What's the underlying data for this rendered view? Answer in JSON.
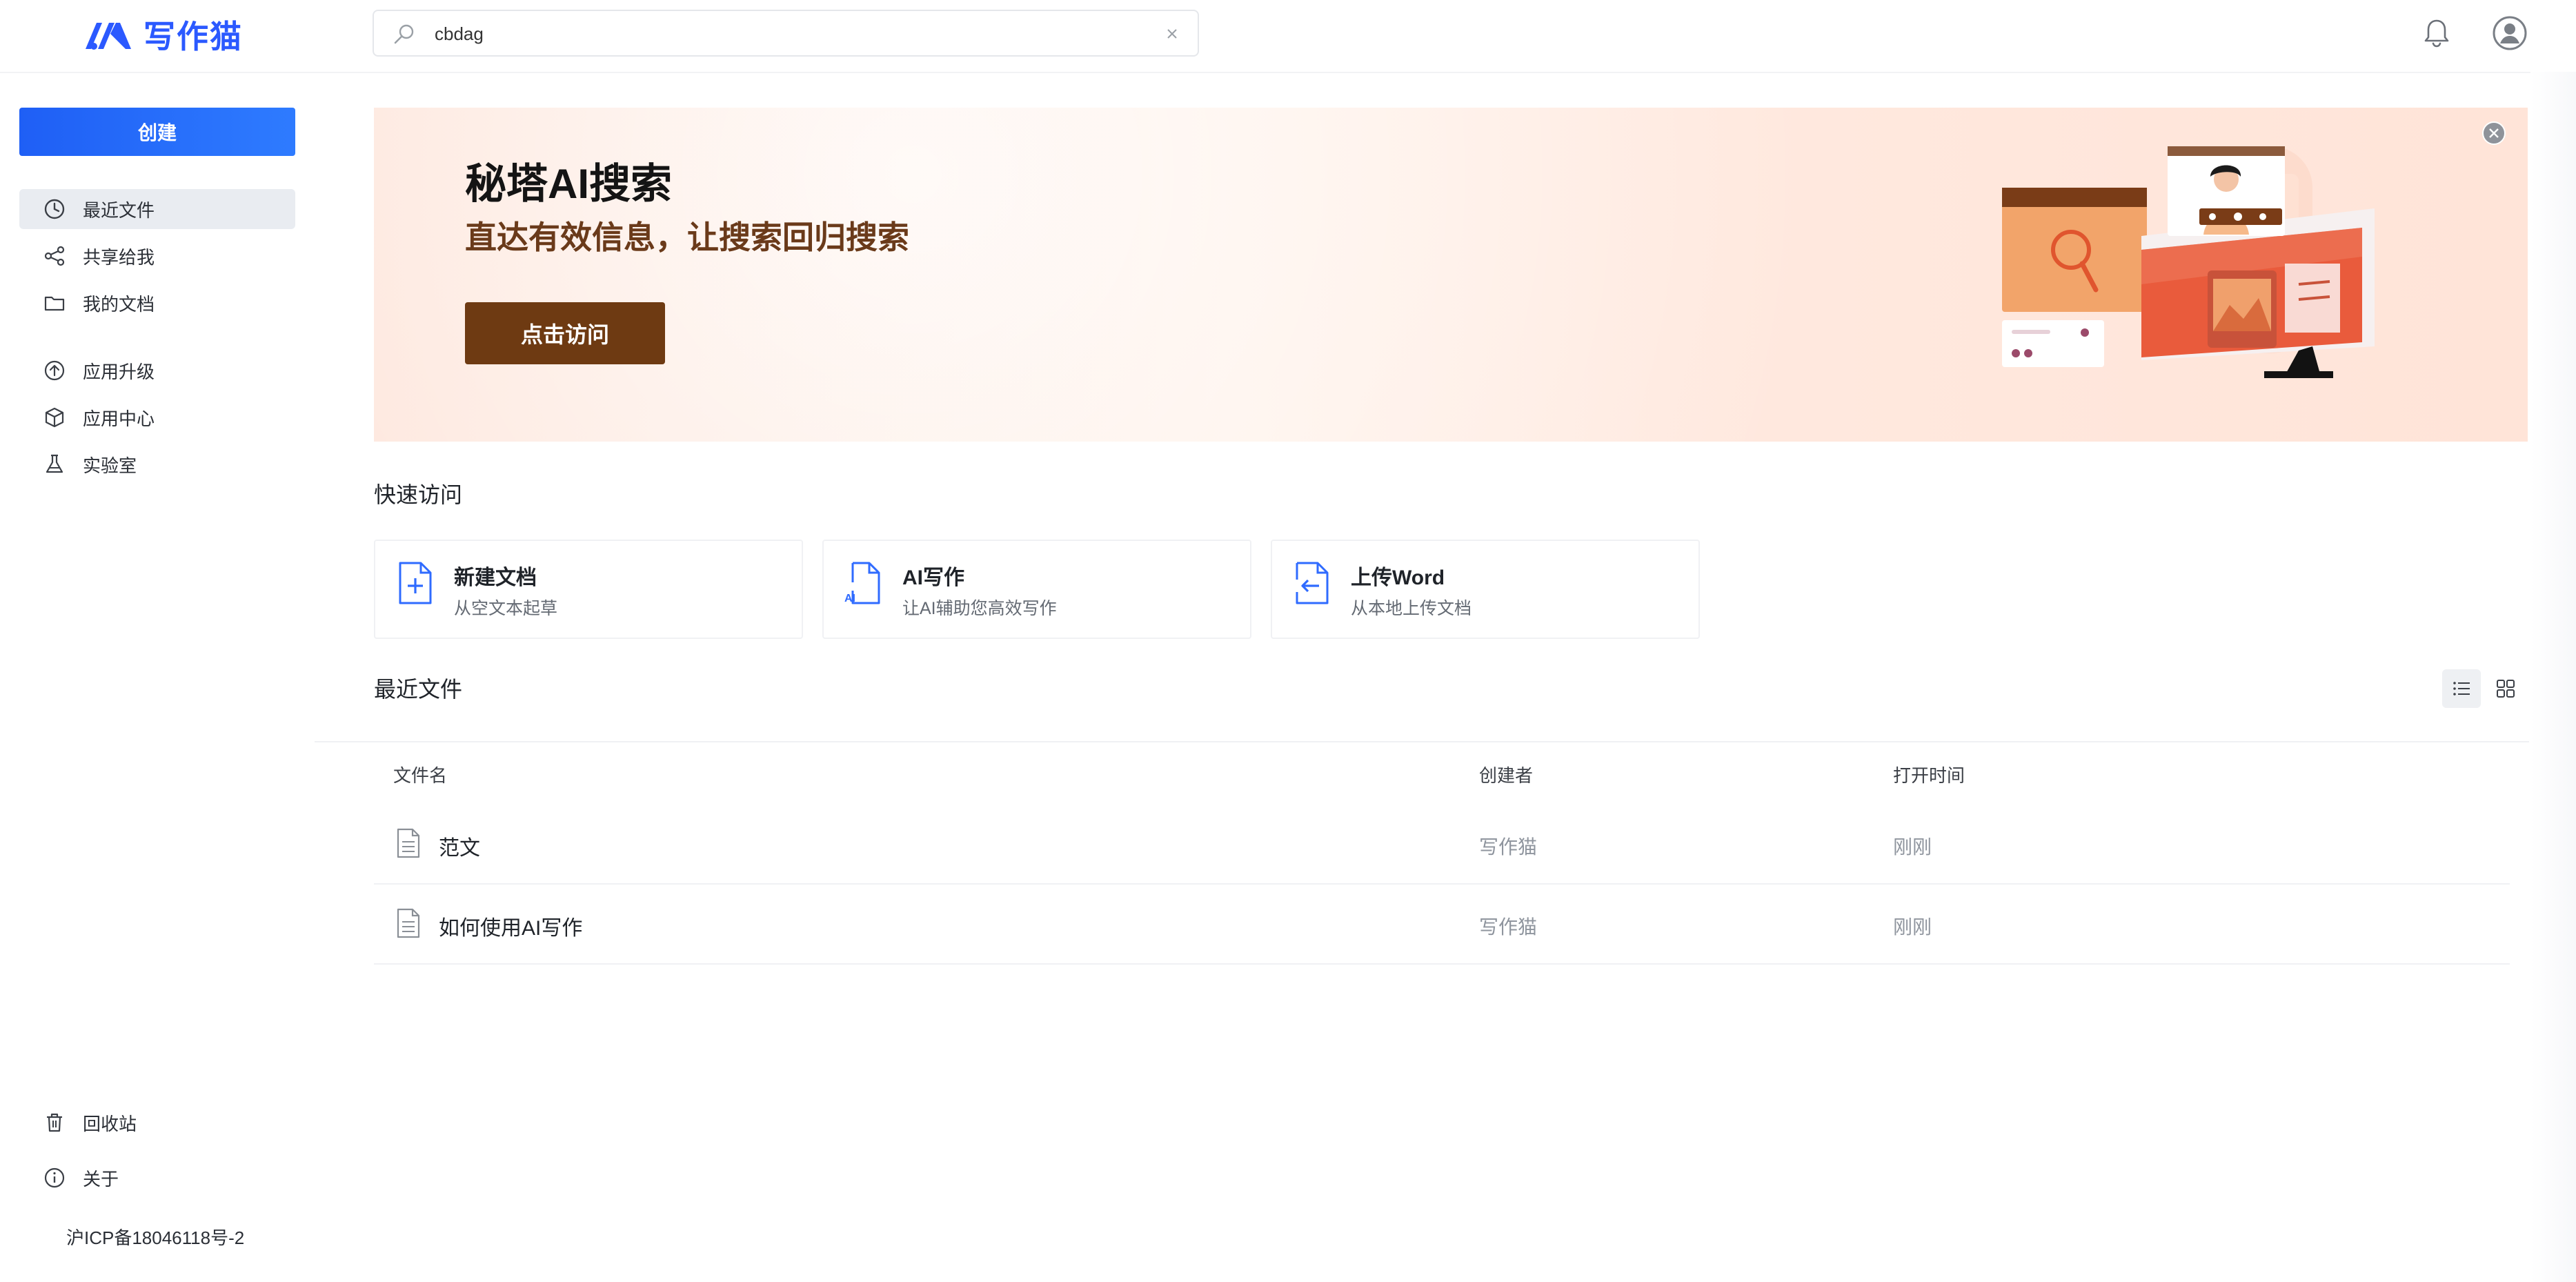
{
  "brand": {
    "name": "写作猫",
    "color": "#2b59ff"
  },
  "search": {
    "value": "cbdag",
    "placeholder": ""
  },
  "sidebar": {
    "create_label": "创建",
    "items": [
      {
        "label": "最近文件",
        "icon": "clock-icon",
        "active": true
      },
      {
        "label": "共享给我",
        "icon": "share-icon"
      },
      {
        "label": "我的文档",
        "icon": "folder-icon"
      },
      {
        "label": "应用升级",
        "icon": "upgrade-icon"
      },
      {
        "label": "应用中心",
        "icon": "cube-icon"
      },
      {
        "label": "实验室",
        "icon": "flask-icon"
      },
      {
        "label": "回收站",
        "icon": "trash-icon"
      },
      {
        "label": "关于",
        "icon": "info-icon"
      }
    ],
    "icp": "沪ICP备18046118号-2"
  },
  "banner": {
    "title": "秘塔AI搜索",
    "subtitle": "直达有效信息，让搜索回归搜索",
    "button_label": "点击访问"
  },
  "quick_access": {
    "title": "快速访问",
    "cards": [
      {
        "title": "新建文档",
        "desc": "从空文本起草",
        "icon": "new-doc-icon"
      },
      {
        "title": "AI写作",
        "desc": "让AI辅助您高效写作",
        "icon": "ai-doc-icon"
      },
      {
        "title": "上传Word",
        "desc": "从本地上传文档",
        "icon": "upload-doc-icon"
      }
    ]
  },
  "recent": {
    "title": "最近文件",
    "columns": [
      "文件名",
      "创建者",
      "打开时间"
    ],
    "rows": [
      {
        "name": "范文",
        "creator": "写作猫",
        "time": "刚刚"
      },
      {
        "name": "如何使用AI写作",
        "creator": "写作猫",
        "time": "刚刚"
      }
    ]
  }
}
